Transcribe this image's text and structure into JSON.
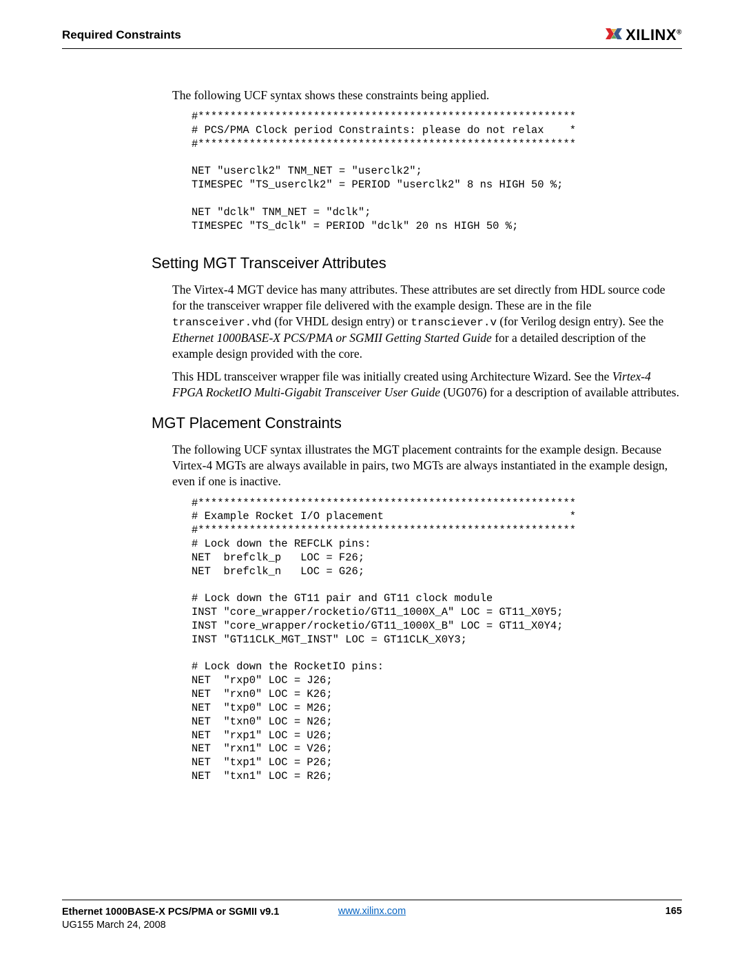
{
  "header": {
    "section": "Required Constraints",
    "brand": "XILINX",
    "registered": "®"
  },
  "intro": "The following UCF syntax shows these constraints being applied.",
  "code1": "#***********************************************************\n# PCS/PMA Clock period Constraints: please do not relax    *\n#***********************************************************\n\nNET \"userclk2\" TNM_NET = \"userclk2\";\nTIMESPEC \"TS_userclk2\" = PERIOD \"userclk2\" 8 ns HIGH 50 %;\n\nNET \"dclk\" TNM_NET = \"dclk\";\nTIMESPEC \"TS_dclk\" = PERIOD \"dclk\" 20 ns HIGH 50 %;",
  "section1": {
    "heading": "Setting MGT Transceiver Attributes",
    "p1a": "The Virtex-4 MGT device has many attributes. These attributes are set directly from HDL source code for the transceiver wrapper file delivered with the example design. These are in the file ",
    "code_a": "transceiver.vhd",
    "p1b": " (for VHDL design entry) or ",
    "code_b": "transciever.v",
    "p1c": " (for Verilog design entry). See the ",
    "italic1": "Ethernet 1000BASE-X PCS/PMA or SGMII Getting Started Guide",
    "p1d": " for a detailed description of the example design provided with the core.",
    "p2a": "This HDL transceiver wrapper file was initially created using Architecture Wizard. See the ",
    "italic2": "Virtex-4 FPGA RocketIO Multi-Gigabit Transceiver User Guide",
    "p2b": " (UG076) for a description of available attributes."
  },
  "section2": {
    "heading": "MGT Placement Constraints",
    "p1": "The following UCF syntax illustrates the MGT placement contraints for the example design. Because Virtex-4 MGTs are always available in pairs, two MGTs are always instantiated in the example design, even if one is inactive."
  },
  "code2": "#***********************************************************\n# Example Rocket I/O placement                             *\n#***********************************************************\n# Lock down the REFCLK pins:\nNET  brefclk_p   LOC = F26;\nNET  brefclk_n   LOC = G26;\n\n# Lock down the GT11 pair and GT11 clock module\nINST \"core_wrapper/rocketio/GT11_1000X_A\" LOC = GT11_X0Y5;\nINST \"core_wrapper/rocketio/GT11_1000X_B\" LOC = GT11_X0Y4;\nINST \"GT11CLK_MGT_INST\" LOC = GT11CLK_X0Y3;\n\n# Lock down the RocketIO pins:\nNET  \"rxp0\" LOC = J26;\nNET  \"rxn0\" LOC = K26;\nNET  \"txp0\" LOC = M26;\nNET  \"txn0\" LOC = N26;\nNET  \"rxp1\" LOC = U26;\nNET  \"rxn1\" LOC = V26;\nNET  \"txp1\" LOC = P26;\nNET  \"txn1\" LOC = R26;",
  "footer": {
    "doc_title": "Ethernet 1000BASE-X PCS/PMA or SGMII v9.1",
    "doc_id": "UG155 March 24, 2008",
    "url": "www.xilinx.com",
    "page": "165"
  }
}
